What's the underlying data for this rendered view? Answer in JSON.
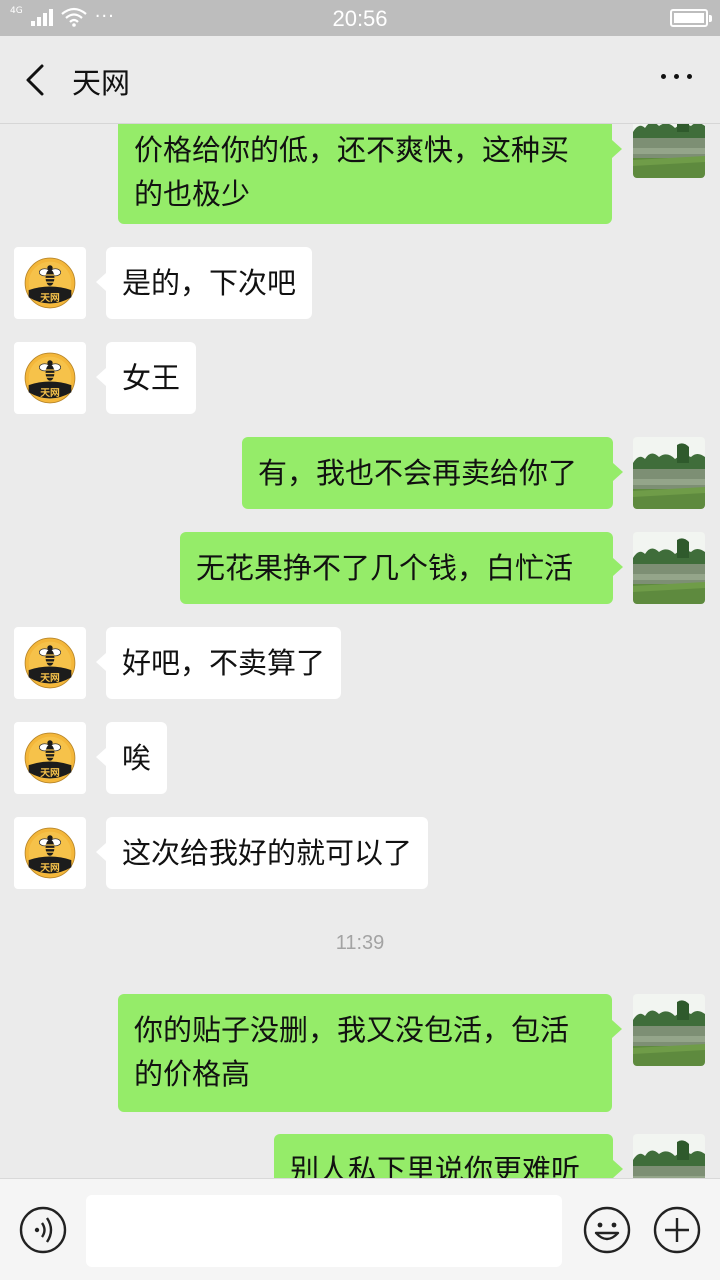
{
  "status_bar": {
    "network": "4G",
    "time": "20:56",
    "more": "···"
  },
  "header": {
    "title": "天网"
  },
  "messages": [
    {
      "from": "me",
      "text_lines": [
        "价格给你的低，还不爽快，这种买",
        "的也极少"
      ]
    },
    {
      "from": "other",
      "text": "是的，下次吧"
    },
    {
      "from": "other",
      "text": "女王"
    },
    {
      "from": "me",
      "text": "有，我也不会再卖给你了"
    },
    {
      "from": "me",
      "text": "无花果挣不了几个钱，白忙活"
    },
    {
      "from": "other",
      "text": "好吧，不卖算了"
    },
    {
      "from": "other",
      "text": "唉"
    },
    {
      "from": "other",
      "text": "这次给我好的就可以了"
    },
    {
      "from": "me",
      "text_lines": [
        "你的贴子没删，我又没包活，包活",
        "的价格高"
      ]
    },
    {
      "from": "me",
      "text": "别人私下里说你更难听"
    }
  ],
  "timestamp": "11:39",
  "avatar_logo_text": "天网",
  "input": {
    "value": ""
  },
  "colors": {
    "my_bubble": "#95ec69",
    "their_bubble": "#ffffff",
    "background": "#ebebeb"
  }
}
